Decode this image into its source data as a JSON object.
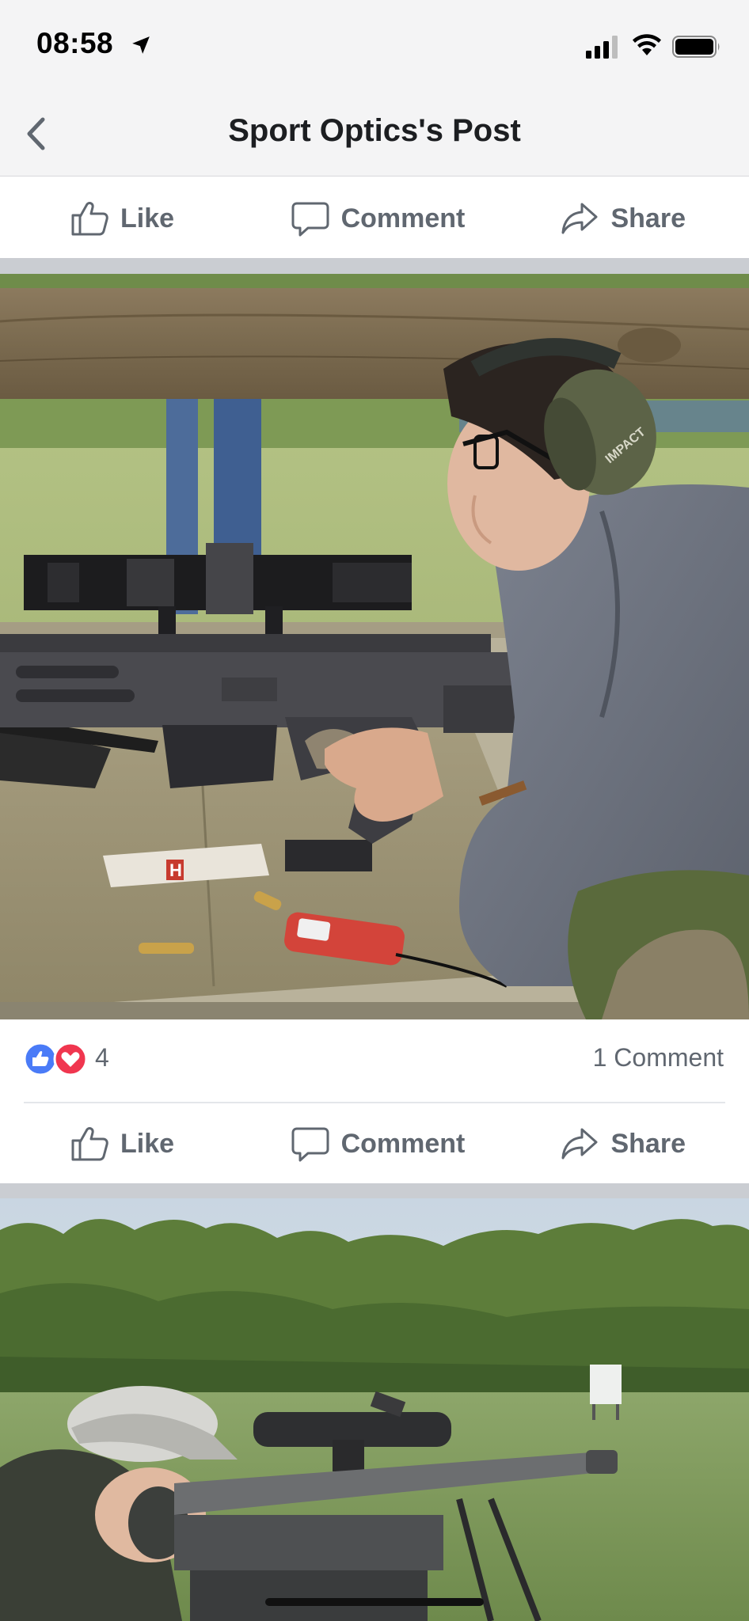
{
  "status_bar": {
    "time": "08:58",
    "icons": [
      "location-arrow-icon",
      "cellular-signal-icon",
      "wifi-icon",
      "battery-icon"
    ]
  },
  "nav": {
    "title": "Sport Optics's Post",
    "back_icon": "chevron-left-icon"
  },
  "actions_top": {
    "like": "Like",
    "comment": "Comment",
    "share": "Share"
  },
  "photo1": {
    "description_icon": "photo",
    "scope_text": "",
    "earmuff_text": "IMPACT",
    "ammo_box_letter": "H"
  },
  "reactions": {
    "icons": [
      "like-reaction-icon",
      "love-reaction-icon"
    ],
    "count": "4",
    "comments": "1 Comment"
  },
  "actions_bottom": {
    "like": "Like",
    "comment": "Comment",
    "share": "Share"
  },
  "colors": {
    "bar_bg": "#f4f4f5",
    "action_text": "#606770",
    "separator": "#cacdd2",
    "like_blue": "#4a7bf7",
    "love_red": "#f0364f"
  }
}
